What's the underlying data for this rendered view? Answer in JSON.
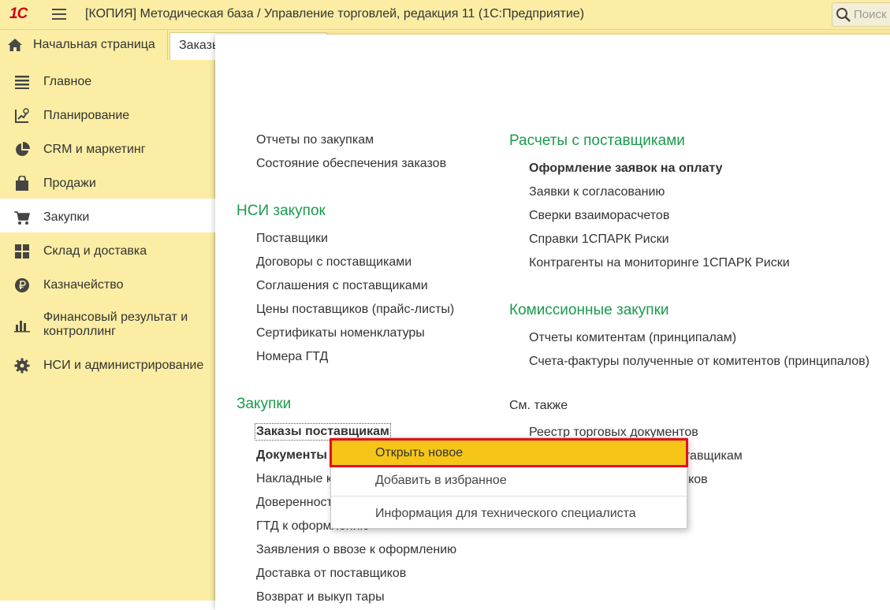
{
  "titlebar": {
    "logo": "1С",
    "app_title": "[КОПИЯ] Методическая база / Управление торговлей, редакция 11  (1С:Предприятие)",
    "search_placeholder": "Поиск"
  },
  "tabs": {
    "home": "Начальная страница",
    "orders": "Заказы поставщикам"
  },
  "sidebar": {
    "items": [
      {
        "label": "Главное",
        "icon": "menu-lines-icon"
      },
      {
        "label": "Планирование",
        "icon": "planning-icon"
      },
      {
        "label": "CRM и маркетинг",
        "icon": "pie-chart-icon"
      },
      {
        "label": "Продажи",
        "icon": "shopping-bag-icon"
      },
      {
        "label": "Закупки",
        "icon": "cart-icon",
        "active": true
      },
      {
        "label": "Склад и доставка",
        "icon": "warehouse-grid-icon"
      },
      {
        "label": "Казначейство",
        "icon": "ruble-coin-icon"
      },
      {
        "label": "Финансовый результат и контроллинг",
        "icon": "bar-chart-icon"
      },
      {
        "label": "НСИ и администрирование",
        "icon": "gear-icon"
      }
    ]
  },
  "main": {
    "left": {
      "top_links": [
        "Отчеты по закупкам",
        "Состояние обеспечения заказов"
      ],
      "nsi_title": "НСИ закупок",
      "nsi_links": [
        "Поставщики",
        "Договоры с поставщиками",
        "Соглашения с поставщиками",
        "Цены поставщиков (прайс-листы)",
        "Сертификаты номенклатуры",
        "Номера ГТД"
      ],
      "purchases_title": "Закупки",
      "purchases_links": [
        "Заказы поставщикам",
        "Документы",
        "Накладные к",
        "Доверенност",
        "ГТД к оформлению",
        "Заявления о ввозе к оформлению",
        "Доставка от поставщиков",
        "Возврат и выкуп тары"
      ]
    },
    "right": {
      "settlements_title": "Расчеты с поставщиками",
      "settlements_links": [
        "Оформление заявок на оплату",
        "Заявки к согласованию",
        "Сверки взаиморасчетов",
        "Справки 1СПАРК Риски",
        "Контрагенты на мониторинге 1СПАРК Риски"
      ],
      "commission_title": "Комиссионные закупки",
      "commission_links": [
        "Отчеты комитентам (принципалам)",
        "Счета-фактуры полученные от комитентов (принципалов)"
      ],
      "see_also_label": "См. также",
      "see_also_links": [
        "Реестр торговых документов",
        "оставщикам",
        "щиков"
      ]
    }
  },
  "context_menu": {
    "items": [
      "Открыть новое",
      "Добавить в избранное",
      "Информация для технического специалиста"
    ]
  },
  "colors": {
    "section_title": "#1a9b4b",
    "sidebar_bg": "#fbeda3",
    "highlight_bg": "#f5c518",
    "highlight_border": "#e0121f",
    "logo": "#d0021b"
  }
}
